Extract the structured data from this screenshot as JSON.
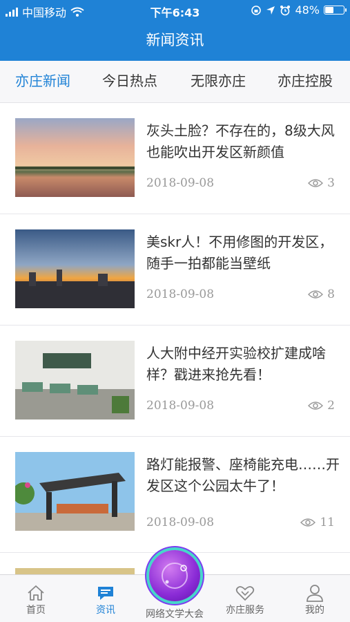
{
  "status_bar": {
    "carrier": "中国移动",
    "time": "下午6:43",
    "battery": "48%",
    "battery_level": 0.48
  },
  "header": {
    "title": "新闻资讯"
  },
  "tabs": [
    {
      "label": "亦庄新闻",
      "active": true
    },
    {
      "label": "今日热点",
      "active": false
    },
    {
      "label": "无限亦庄",
      "active": false
    },
    {
      "label": "亦庄控股",
      "active": false
    }
  ],
  "news": [
    {
      "title": "灰头土脸？不存在的，8级大风也能吹出开发区新颜值",
      "date": "2018-09-08",
      "views": "3",
      "image": "sunset-lake-photo"
    },
    {
      "title": "美skr人！不用修图的开发区，随手一拍都能当壁纸",
      "date": "2018-09-08",
      "views": "8",
      "image": "city-sunset-photo"
    },
    {
      "title": "人大附中经开实验校扩建成啥样？戳进来抢先看！",
      "date": "2018-09-08",
      "views": "2",
      "image": "classroom-photo"
    },
    {
      "title": "路灯能报警、座椅能充电……开发区这个公园太牛了！",
      "date": "2018-09-08",
      "views": "11",
      "image": "park-pavilion-photo"
    }
  ],
  "bottom_nav": [
    {
      "label": "首页",
      "icon": "home-icon",
      "active": false
    },
    {
      "label": "资讯",
      "icon": "news-icon",
      "active": true
    },
    {
      "label": "网络文学大会",
      "icon": "planet-icon",
      "active": false
    },
    {
      "label": "亦庄服务",
      "icon": "handshake-icon",
      "active": false
    },
    {
      "label": "我的",
      "icon": "user-icon",
      "active": false
    }
  ],
  "colors": {
    "accent": "#1f82d6",
    "text": "#333333",
    "muted": "#999999"
  }
}
